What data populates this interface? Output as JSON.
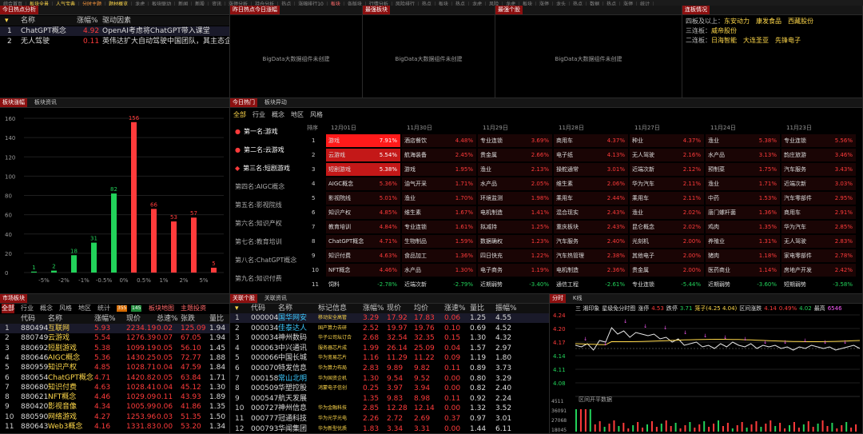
{
  "top_nav": [
    "综合首页",
    "板块全景",
    "人气宝典",
    "分时主题",
    "题材概览",
    "龙虎",
    "板块联动",
    "新闻",
    "新股",
    "资讯",
    "涨停分析",
    "持仓分析",
    "热点",
    "涨幅排行10",
    "板块",
    "各版块",
    "行情分析",
    "风险排行",
    "热点",
    "板块",
    "热点",
    "龙虎",
    "风险",
    "龙虎",
    "板块",
    "涨停",
    "龙头",
    "热点",
    "数据",
    "热点",
    "涨停",
    "统计"
  ],
  "hot_today": {
    "title": "今日热点分析",
    "cols": [
      "名称",
      "涨幅%",
      "驱动因素"
    ],
    "rows": [
      {
        "idx": "1",
        "name": "ChatGPT概念",
        "chg": "4.92",
        "reason": "OpenAI考虑将ChatGPT带入课堂"
      },
      {
        "idx": "2",
        "name": "无人驾驶",
        "chg": "0.11",
        "reason": "英伟达扩大自动驾驶中国团队，其主态企"
      }
    ]
  },
  "big_panels": [
    {
      "title": "昨日热点今日涨幅",
      "text": "BigData大数据组件未创建"
    },
    {
      "title": "最强板块",
      "text": "BigData大数据组件未创建"
    },
    {
      "title": "最强个股",
      "text": "BigData大数据组件未创建"
    }
  ],
  "lianban": {
    "title": "连板情况",
    "rows": [
      {
        "label": "四板及以上：",
        "items": [
          "东安动力",
          "康发食品",
          "西藏股份"
        ]
      },
      {
        "label": "三连板：",
        "items": [
          "威帝股份"
        ]
      },
      {
        "label": "二连板：",
        "items": [
          "日海智能",
          "大连圣亚",
          "先锋电子"
        ]
      }
    ]
  },
  "dist": {
    "tabs": [
      "板块涨幅",
      "板块资讯"
    ],
    "yticks": [
      "160",
      "140",
      "120",
      "100",
      "80",
      "60",
      "40",
      "20",
      "0"
    ],
    "chart_data": {
      "type": "bar",
      "categories": [
        "-5%",
        "-2%",
        "-1%",
        "-0.5%",
        "0%",
        "0.5%",
        "1%",
        "2%",
        "5%"
      ],
      "values": [
        1,
        2,
        18,
        31,
        82,
        156,
        66,
        53,
        57,
        5
      ],
      "value_labels": [
        "1",
        "2",
        "18",
        "31",
        "82",
        "156",
        "66",
        "53",
        "57",
        "5"
      ],
      "colors": [
        "#22d25a",
        "#22d25a",
        "#22d25a",
        "#22d25a",
        "#22d25a",
        "#ff3b3b",
        "#ff3b3b",
        "#ff3b3b",
        "#ff3b3b",
        "#ff3b3b"
      ],
      "ylim": [
        0,
        160
      ]
    }
  },
  "hot_rank": {
    "tabs": [
      "今日热门",
      "板块异动"
    ],
    "filters": [
      "全部",
      "行业",
      "概念",
      "地区",
      "风格"
    ],
    "left_list": [
      "第一名:游戏",
      "第二名:云游戏",
      "第三名:短剧游戏",
      "第四名:AIGC概念",
      "第五名:影视院线",
      "第六名:知识产权",
      "第七名:教育培训",
      "第八名:ChatGPT概念",
      "第九名:知识付费"
    ],
    "rank_label": "排序",
    "dates": [
      "12月01日",
      "11月30日",
      "11月29日",
      "11月28日",
      "11月27日",
      "11月24日",
      "11月23日"
    ],
    "rows": [
      [
        [
          "游戏",
          "7.91%"
        ],
        [
          "酒店餐饮",
          "4.48%"
        ],
        [
          "专业连锁",
          "3.69%"
        ],
        [
          "商用车",
          "4.37%"
        ],
        [
          "种业",
          "4.37%"
        ],
        [
          "渔业",
          "5.38%"
        ],
        [
          "专业连锁",
          "5.56%"
        ]
      ],
      [
        [
          "云游戏",
          "5.54%"
        ],
        [
          "航海装备",
          "2.45%"
        ],
        [
          "贵金属",
          "2.66%"
        ],
        [
          "电子纸",
          "4.13%"
        ],
        [
          "无人驾驶",
          "2.16%"
        ],
        [
          "水产品",
          "3.13%"
        ],
        [
          "韵庄旅游",
          "3.46%"
        ]
      ],
      [
        [
          "短剧游戏",
          "5.38%"
        ],
        [
          "游戏",
          "1.95%"
        ],
        [
          "渔业",
          "2.13%"
        ],
        [
          "操舵通常",
          "3.01%"
        ],
        [
          "近端次新",
          "2.12%"
        ],
        [
          "预制菜",
          "1.75%"
        ],
        [
          "汽车服务",
          "3.43%"
        ]
      ],
      [
        [
          "AIGC概念",
          "5.36%"
        ],
        [
          "油气开采",
          "1.71%"
        ],
        [
          "水产品",
          "2.05%"
        ],
        [
          "维生素",
          "2.06%"
        ],
        [
          "华为汽车",
          "2.11%"
        ],
        [
          "渔业",
          "1.71%"
        ],
        [
          "近端次新",
          "3.03%"
        ]
      ],
      [
        [
          "影视院线",
          "5.01%"
        ],
        [
          "渔业",
          "1.70%"
        ],
        [
          "环境监测",
          "1.98%"
        ],
        [
          "乘用车",
          "2.44%"
        ],
        [
          "乘用车",
          "2.11%"
        ],
        [
          "中药",
          "1.53%"
        ],
        [
          "汽车零部件",
          "2.95%"
        ]
      ],
      [
        [
          "知识产权",
          "4.85%"
        ],
        [
          "维生素",
          "1.67%"
        ],
        [
          "电机制造",
          "1.41%"
        ],
        [
          "混合现实",
          "2.43%"
        ],
        [
          "渔业",
          "2.02%"
        ],
        [
          "唐门螺杆菌",
          "1.36%"
        ],
        [
          "商用车",
          "2.91%"
        ]
      ],
      [
        [
          "教育培训",
          "4.84%"
        ],
        [
          "专业连锁",
          "1.61%"
        ],
        [
          "拟减持",
          "1.25%"
        ],
        [
          "重庆板块",
          "2.43%"
        ],
        [
          "昆仑概念",
          "2.02%"
        ],
        [
          "鸡肉",
          "1.35%"
        ],
        [
          "华为汽车",
          "2.85%"
        ]
      ],
      [
        [
          "ChatGPT概念",
          "4.71%"
        ],
        [
          "生物制品",
          "1.59%"
        ],
        [
          "数据确权",
          "1.23%"
        ],
        [
          "汽车服务",
          "2.40%"
        ],
        [
          "光刻机",
          "2.00%"
        ],
        [
          "养殖业",
          "1.31%"
        ],
        [
          "无人驾驶",
          "2.83%"
        ]
      ],
      [
        [
          "知识付费",
          "4.63%"
        ],
        [
          "食品加工",
          "1.36%"
        ],
        [
          "四日快充",
          "1.22%"
        ],
        [
          "汽车热管理",
          "2.38%"
        ],
        [
          "其他电子",
          "2.00%"
        ],
        [
          "猪肉",
          "1.18%"
        ],
        [
          "家电零部件",
          "2.78%"
        ]
      ],
      [
        [
          "NFT概念",
          "4.46%"
        ],
        [
          "水产品",
          "1.30%"
        ],
        [
          "电子商务",
          "1.19%"
        ],
        [
          "电机制造",
          "2.36%"
        ],
        [
          "贵金属",
          "2.00%"
        ],
        [
          "医药商业",
          "1.14%"
        ],
        [
          "房地产开发",
          "2.42%"
        ]
      ],
      [
        [
          "饲料",
          "-2.78%"
        ],
        [
          "近端次新",
          "-2.79%"
        ],
        [
          "近期弱势",
          "-3.40%"
        ],
        [
          "通信工程",
          "-2.61%"
        ],
        [
          "专业连锁",
          "-5.44%"
        ],
        [
          "近期弱势",
          "-3.60%"
        ],
        [
          "短期弱势",
          "-3.58%"
        ]
      ]
    ],
    "red_fill": [
      "#ff1a1a",
      "#c41818",
      "#c41818"
    ]
  },
  "sector_table": {
    "tabs": [
      "市场板块",
      "全部",
      "行业",
      "概念",
      "风格",
      "地区",
      "统计",
      "板块地图",
      "主题投资"
    ],
    "counts": [
      "355",
      "145"
    ],
    "cols": [
      "代码",
      "名称",
      "涨幅%",
      "现价",
      "总速%",
      "张跌",
      "量比"
    ],
    "rows": [
      [
        "880494",
        "互联网",
        "5.93",
        "2234.19",
        "0.02",
        "125.09",
        "1.94"
      ],
      [
        "880749",
        "云游戏",
        "5.54",
        "1276.39",
        "0.07",
        "67.05",
        "1.94"
      ],
      [
        "880692",
        "短剧游戏",
        "5.38",
        "1099.19",
        "0.05",
        "56.10",
        "1.45"
      ],
      [
        "880646",
        "AIGC概念",
        "5.36",
        "1430.25",
        "0.05",
        "72.77",
        "1.88"
      ],
      [
        "880959",
        "知识产权",
        "4.85",
        "1028.71",
        "0.04",
        "47.59",
        "1.84"
      ],
      [
        "880654",
        "ChatGPT概念",
        "4.71",
        "1420.82",
        "0.05",
        "63.84",
        "1.71"
      ],
      [
        "880680",
        "知识付费",
        "4.63",
        "1028.41",
        "0.04",
        "45.12",
        "1.30"
      ],
      [
        "880621",
        "NFT概念",
        "4.46",
        "1029.09",
        "0.11",
        "43.93",
        "1.89"
      ],
      [
        "880420",
        "影视音像",
        "4.34",
        "1005.99",
        "0.06",
        "41.86",
        "1.35"
      ],
      [
        "880590",
        "网络游戏",
        "4.27",
        "1253.96",
        "0.03",
        "51.35",
        "1.50"
      ],
      [
        "880643",
        "Web3概念",
        "4.16",
        "1331.83",
        "0.00",
        "53.20",
        "1.34"
      ]
    ]
  },
  "stock_table": {
    "tabs": [
      "关联个股",
      "关联资讯"
    ],
    "cols": [
      "代码",
      "名称",
      "标记信息",
      "涨幅%",
      "现价",
      "均价",
      "涨速%",
      "量比",
      "振幅%"
    ],
    "rows": [
      [
        "1",
        "000004",
        "国华网安",
        "移动安全高管",
        "3.29",
        "17.92",
        "17.83",
        "0.06",
        "1.25",
        "4.55"
      ],
      [
        "2",
        "000034",
        "佳泰达人",
        "国产算力去研",
        "2.52",
        "19.97",
        "19.76",
        "0.10",
        "0.69",
        "4.52"
      ],
      [
        "3",
        "000034",
        "神州数码",
        "华子公司坛订合",
        "2.68",
        "32.54",
        "32.35",
        "0.15",
        "1.30",
        "4.32"
      ],
      [
        "4",
        "000063",
        "中兴通讯",
        "服务器芯片成",
        "1.99",
        "26.14",
        "25.09",
        "0.04",
        "1.57",
        "2.97"
      ],
      [
        "5",
        "000066",
        "中国长城",
        "华为宽易芯片",
        "1.16",
        "11.29",
        "11.22",
        "0.09",
        "1.19",
        "1.80"
      ],
      [
        "6",
        "000070",
        "特发信息",
        "华为算力布局",
        "2.83",
        "9.89",
        "9.82",
        "0.11",
        "0.89",
        "3.73"
      ],
      [
        "7",
        "000158",
        "常山北明",
        "华为国资企机",
        "1.30",
        "9.54",
        "9.52",
        "0.00",
        "0.80",
        "3.29"
      ],
      [
        "8",
        "000509",
        "华塑控股",
        "鸿蒙电子信创",
        "0.25",
        "3.97",
        "3.94",
        "0.00",
        "0.82",
        "2.40"
      ],
      [
        "9",
        "000547",
        "航天发展",
        "",
        "1.35",
        "9.83",
        "8.98",
        "0.11",
        "0.92",
        "2.24"
      ],
      [
        "10",
        "000727",
        "神州信息",
        "华为金融科技",
        "2.85",
        "12.28",
        "12.14",
        "0.00",
        "1.32",
        "3.52"
      ],
      [
        "11",
        "000777",
        "冠通科技",
        "华为光学光电",
        "2.26",
        "2.72",
        "2.69",
        "0.37",
        "0.97",
        "3.01"
      ],
      [
        "12",
        "000793",
        "华闻集团",
        "华为新型优质",
        "1.83",
        "3.34",
        "3.31",
        "0.00",
        "1.44",
        "6.11"
      ]
    ]
  },
  "intraday": {
    "tabs": [
      "分时",
      "K线"
    ],
    "info": [
      {
        "text": "三 湘印象",
        "c": "wht"
      },
      {
        "text": "星级免分时图",
        "c": "wht"
      },
      {
        "text": "涨停",
        "c": "wht"
      },
      {
        "text": "4.53",
        "c": "red"
      },
      {
        "text": "跌停",
        "c": "wht"
      },
      {
        "text": "3.71",
        "c": "grn"
      },
      {
        "text": "笼子(4.25 4.04)",
        "c": "yel"
      },
      {
        "text": "区间涨跌",
        "c": "wht"
      },
      {
        "text": "4.14",
        "c": "red"
      },
      {
        "text": "0.49%",
        "c": "red"
      },
      {
        "text": "4.02",
        "c": "grn"
      },
      {
        "text": "最高",
        "c": "wht"
      },
      {
        "text": "6546",
        "c": "mag"
      }
    ],
    "price_ticks": [
      "4.24",
      "4.20",
      "4.17",
      "4.14",
      "4.11",
      "4.08"
    ],
    "vol_ticks": [
      "4511",
      "36091",
      "27068",
      "18045"
    ],
    "vol_note": "区间开平数据"
  }
}
